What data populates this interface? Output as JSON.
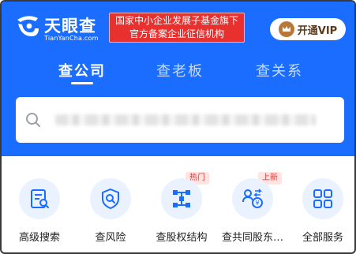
{
  "brand": {
    "name": "天眼查",
    "domain": "TianYanCha.com"
  },
  "official_notice": {
    "line1": "国家中小企业发展子基金旗下",
    "line2": "官方备案企业征信机构"
  },
  "vip": {
    "label": "开通VIP",
    "icon": "crown-icon"
  },
  "tabs": [
    {
      "label": "查公司",
      "active": true
    },
    {
      "label": "查老板",
      "active": false
    },
    {
      "label": "查关系",
      "active": false
    }
  ],
  "search": {
    "icon": "search-icon",
    "placeholder": ""
  },
  "features": [
    {
      "label": "高级搜索",
      "icon": "advanced-search-icon",
      "tag": ""
    },
    {
      "label": "查风险",
      "icon": "risk-shield-icon",
      "tag": ""
    },
    {
      "label": "查股权结构",
      "icon": "equity-structure-icon",
      "tag": "热门"
    },
    {
      "label": "查共同股东…",
      "icon": "common-shareholder-icon",
      "tag": "上新"
    },
    {
      "label": "全部服务",
      "icon": "all-services-icon",
      "tag": ""
    }
  ],
  "colors": {
    "primary": "#1a6dff",
    "badge_red": "#e8302e",
    "vip_gold": "#b8783a"
  }
}
